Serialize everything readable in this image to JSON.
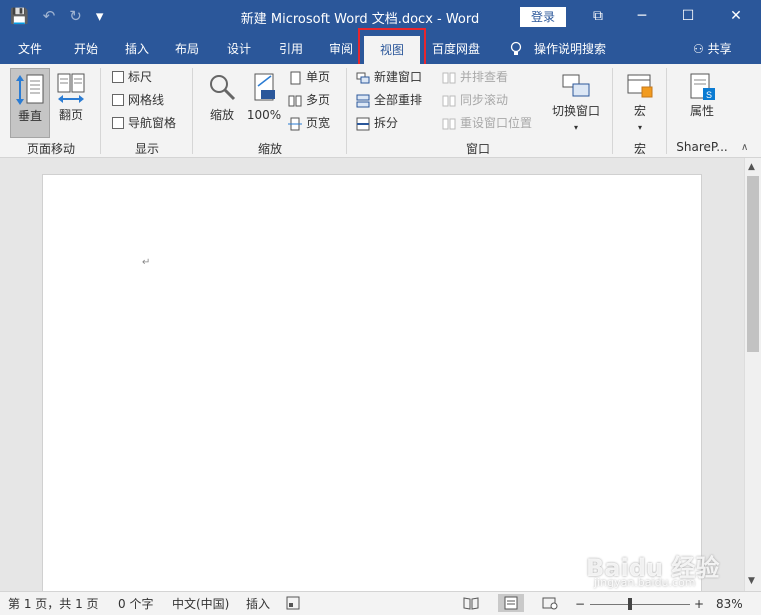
{
  "app": {
    "title": "新建 Microsoft Word 文档.docx  -  Word",
    "login": "登录",
    "qat": {
      "save": "💾",
      "undo": "↶",
      "redo": "↻",
      "customize": "▾"
    },
    "window": {
      "restore": "⧉",
      "minimize": "─",
      "maximize": "☐",
      "close": "✕"
    }
  },
  "tabs": [
    {
      "label": "文件"
    },
    {
      "label": "开始"
    },
    {
      "label": "插入"
    },
    {
      "label": "布局"
    },
    {
      "label": "设计"
    },
    {
      "label": "引用"
    },
    {
      "label": "审阅"
    },
    {
      "label": "视图"
    },
    {
      "label": "百度网盘"
    },
    {
      "label": "操作说明搜索"
    }
  ],
  "share": "共享",
  "ribbon": {
    "page_move": {
      "vertical": "垂直",
      "flip": "翻页",
      "label": "页面移动"
    },
    "show": {
      "ruler": "标尺",
      "gridlines": "网格线",
      "nav_pane": "导航窗格",
      "label": "显示"
    },
    "zoom": {
      "zoom": "缩放",
      "hundred": "100%",
      "one_page": "单页",
      "multi_page": "多页",
      "page_width": "页宽",
      "label": "缩放"
    },
    "window": {
      "new_window": "新建窗口",
      "arrange_all": "全部重排",
      "split": "拆分",
      "side_by_side": "并排查看",
      "sync_scroll": "同步滚动",
      "reset_position": "重设窗口位置",
      "switch_window": "切换窗口",
      "label": "窗口"
    },
    "macros": {
      "macros": "宏",
      "label": "宏"
    },
    "sharepoint": {
      "properties": "属性",
      "label": "ShareP..."
    },
    "collapse": "∧"
  },
  "document": {
    "para_mark": "↵"
  },
  "status": {
    "page": "第 1 页，共 1 页",
    "words": "0 个字",
    "language": "中文(中国)",
    "mode": "插入",
    "zoom": "83%",
    "minus": "−",
    "plus": "+"
  },
  "watermark": {
    "main": "Baidu 经验",
    "sub": "jingyan.baidu.com"
  },
  "colors": {
    "accent": "#2b579a",
    "highlight": "#e8262e",
    "ribbon_bg": "#f3f3f3"
  }
}
